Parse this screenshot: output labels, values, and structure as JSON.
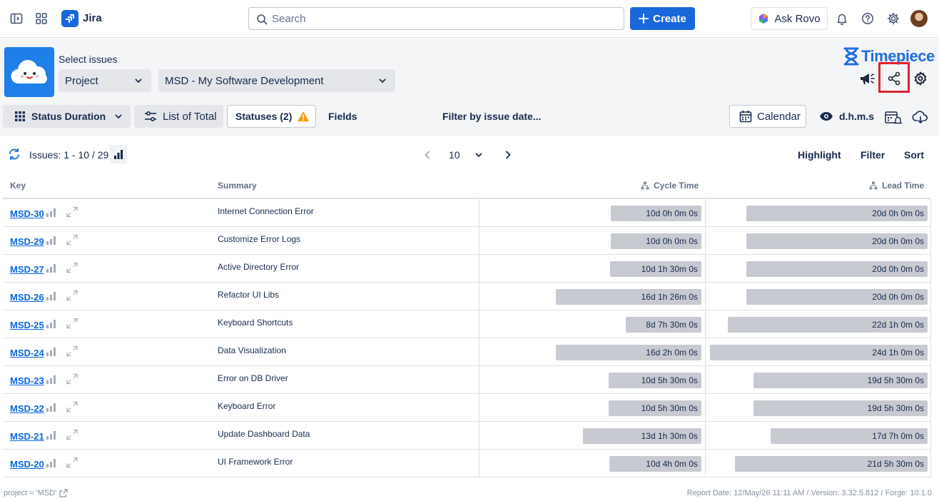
{
  "topbar": {
    "app_name": "Jira",
    "search_placeholder": "Search",
    "create_label": "Create",
    "ask_rovo_label": "Ask Rovo"
  },
  "header": {
    "select_label": "Select issues",
    "project_dropdown": "Project",
    "project_value": "MSD - My Software Development",
    "brand_name": "Timepiece"
  },
  "toolbar": {
    "status_duration": "Status Duration",
    "list_of_total": "List of Total",
    "statuses": "Statuses (2)",
    "fields": "Fields",
    "filter_by_date": "Filter by issue date...",
    "calendar": "Calendar",
    "format": "d.h.m.s"
  },
  "pagination": {
    "issues_text": "Issues: 1 - 10 / 29",
    "per_page": "10",
    "highlight": "Highlight",
    "filter": "Filter",
    "sort": "Sort"
  },
  "table": {
    "headers": {
      "key": "Key",
      "summary": "Summary",
      "cycle_time": "Cycle Time",
      "lead_time": "Lead Time"
    },
    "rows": [
      {
        "key": "MSD-30",
        "summary": "Internet Connection Error",
        "cycle": "10d 0h 0m 0s",
        "cycle_days": 10.0,
        "lead": "20d 0h 0m 0s",
        "lead_days": 20.0
      },
      {
        "key": "MSD-29",
        "summary": "Customize Error Logs",
        "cycle": "10d 0h 0m 0s",
        "cycle_days": 10.0,
        "lead": "20d 0h 0m 0s",
        "lead_days": 20.0
      },
      {
        "key": "MSD-27",
        "summary": "Active Directory Error",
        "cycle": "10d 1h 30m 0s",
        "cycle_days": 10.06,
        "lead": "20d 0h 0m 0s",
        "lead_days": 20.0
      },
      {
        "key": "MSD-26",
        "summary": "Refactor UI Libs",
        "cycle": "16d 1h 26m 0s",
        "cycle_days": 16.06,
        "lead": "20d 0h 0m 0s",
        "lead_days": 20.0
      },
      {
        "key": "MSD-25",
        "summary": "Keyboard Shortcuts",
        "cycle": "8d 7h 30m 0s",
        "cycle_days": 8.31,
        "lead": "22d 1h 0m 0s",
        "lead_days": 22.04
      },
      {
        "key": "MSD-24",
        "summary": "Data Visualization",
        "cycle": "16d 2h 0m 0s",
        "cycle_days": 16.08,
        "lead": "24d 1h 0m 0s",
        "lead_days": 24.04
      },
      {
        "key": "MSD-23",
        "summary": "Error on DB Driver",
        "cycle": "10d 5h 30m 0s",
        "cycle_days": 10.23,
        "lead": "19d 5h 30m 0s",
        "lead_days": 19.23
      },
      {
        "key": "MSD-22",
        "summary": "Keyboard Error",
        "cycle": "10d 5h 30m 0s",
        "cycle_days": 10.23,
        "lead": "19d 5h 30m 0s",
        "lead_days": 19.23
      },
      {
        "key": "MSD-21",
        "summary": "Update Dashboard Data",
        "cycle": "13d 1h 30m 0s",
        "cycle_days": 13.06,
        "lead": "17d 7h 0m 0s",
        "lead_days": 17.29
      },
      {
        "key": "MSD-20",
        "summary": "UI Framework Error",
        "cycle": "10d 4h 0m 0s",
        "cycle_days": 10.17,
        "lead": "21d 5h 30m 0s",
        "lead_days": 21.23
      }
    ]
  },
  "footer": {
    "jql": "project = 'MSD'",
    "report_info": "Report Date: 12/May/26 11:11 AM / Version: 3.32.5.812 / Forge: 10.1.0"
  },
  "colors": {
    "accent": "#1868db",
    "highlight_box": "#e0242b",
    "bar": "#c8cad1"
  }
}
